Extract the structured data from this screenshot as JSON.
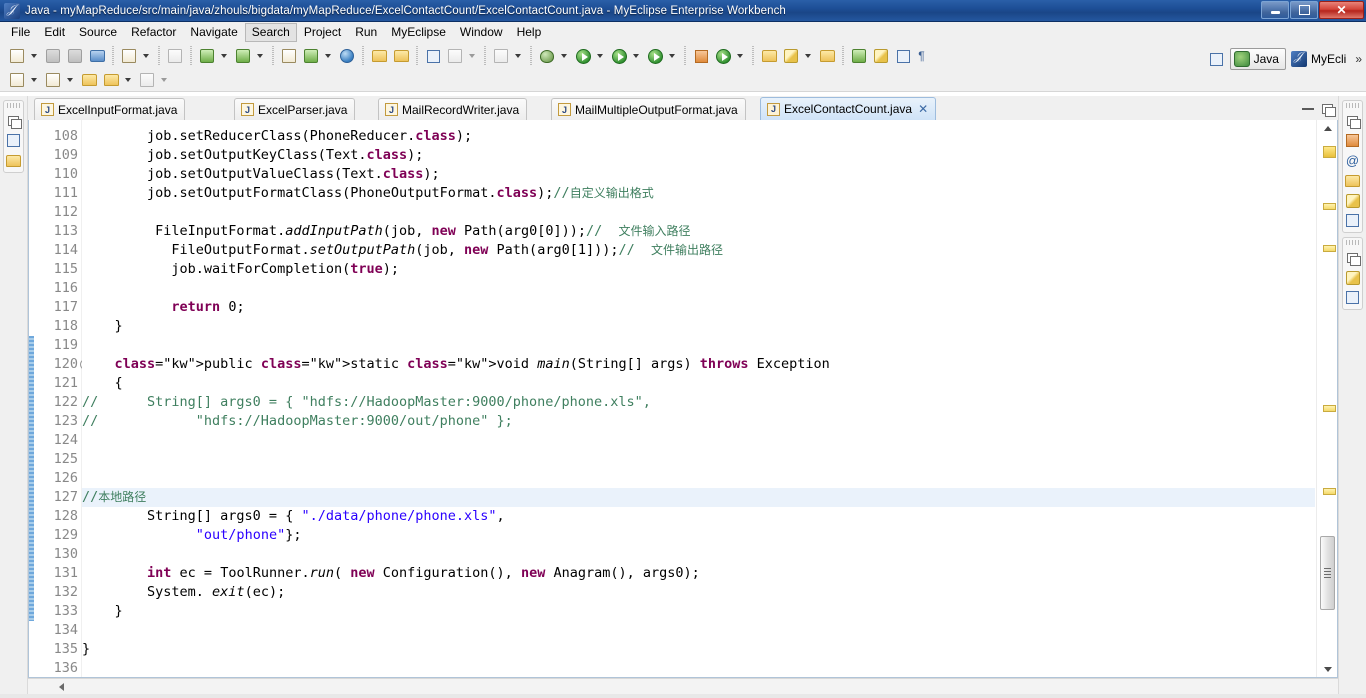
{
  "window": {
    "title": "Java - myMapReduce/src/main/java/zhouls/bigdata/myMapReduce/ExcelContactCount/ExcelContactCount.java - MyEclipse Enterprise Workbench",
    "app_icon": "myeclipse-icon",
    "controls": {
      "minimize": "–",
      "restore": "❐",
      "close": "✕"
    }
  },
  "menubar": {
    "items": [
      {
        "label": "File",
        "active": false
      },
      {
        "label": "Edit",
        "active": false
      },
      {
        "label": "Source",
        "active": false
      },
      {
        "label": "Refactor",
        "active": false
      },
      {
        "label": "Navigate",
        "active": false
      },
      {
        "label": "Search",
        "active": true
      },
      {
        "label": "Project",
        "active": false
      },
      {
        "label": "Run",
        "active": false
      },
      {
        "label": "MyEclipse",
        "active": false
      },
      {
        "label": "Window",
        "active": false
      },
      {
        "label": "Help",
        "active": false
      }
    ]
  },
  "perspective": {
    "open_perspective_label": "",
    "items": [
      {
        "label": "Java",
        "selected": true,
        "icon": "java-perspective-icon"
      },
      {
        "label": "MyEcli",
        "selected": false,
        "icon": "myeclipse-perspective-icon"
      }
    ],
    "overflow": "»"
  },
  "tabs": [
    {
      "label": "ExcelInputFormat.java",
      "active": false,
      "icon": "java-file-icon",
      "closable": false
    },
    {
      "label": "ExcelParser.java",
      "active": false,
      "icon": "java-file-icon",
      "closable": false
    },
    {
      "label": "MailRecordWriter.java",
      "active": false,
      "icon": "java-file-icon",
      "closable": false
    },
    {
      "label": "MailMultipleOutputFormat.java",
      "active": false,
      "icon": "java-file-icon",
      "closable": false
    },
    {
      "label": "ExcelContactCount.java",
      "active": true,
      "icon": "java-file-warning-icon",
      "closable": true,
      "close_glyph": "✕"
    }
  ],
  "editor": {
    "first_line": 108,
    "current_line": 127,
    "fold_marker_line": 120,
    "lines": [
      {
        "n": 108,
        "text": "        job.setReducerClass(PhoneReducer.class);"
      },
      {
        "n": 109,
        "text": "        job.setOutputKeyClass(Text.class);"
      },
      {
        "n": 110,
        "text": "        job.setOutputValueClass(Text.class);"
      },
      {
        "n": 111,
        "text": "        job.setOutputFormatClass(PhoneOutputFormat.class);//自定义输出格式"
      },
      {
        "n": 112,
        "text": ""
      },
      {
        "n": 113,
        "text": "         FileInputFormat.addInputPath(job, new Path(arg0[0]));//  文件输入路径"
      },
      {
        "n": 114,
        "text": "           FileOutputFormat.setOutputPath(job, new Path(arg0[1]));//  文件输出路径"
      },
      {
        "n": 115,
        "text": "           job.waitForCompletion(true);"
      },
      {
        "n": 116,
        "text": ""
      },
      {
        "n": 117,
        "text": "           return 0;"
      },
      {
        "n": 118,
        "text": "    }"
      },
      {
        "n": 119,
        "text": ""
      },
      {
        "n": 120,
        "text": "    public static void main(String[] args) throws Exception"
      },
      {
        "n": 121,
        "text": "    {"
      },
      {
        "n": 122,
        "text": "//      String[] args0 = { \"hdfs://HadoopMaster:9000/phone/phone.xls\","
      },
      {
        "n": 123,
        "text": "//            \"hdfs://HadoopMaster:9000/out/phone\" };"
      },
      {
        "n": 124,
        "text": ""
      },
      {
        "n": 125,
        "text": ""
      },
      {
        "n": 126,
        "text": ""
      },
      {
        "n": 127,
        "text": "//本地路径"
      },
      {
        "n": 128,
        "text": "        String[] args0 = { \"./data/phone/phone.xls\","
      },
      {
        "n": 129,
        "text": "              \"out/phone\"};"
      },
      {
        "n": 130,
        "text": ""
      },
      {
        "n": 131,
        "text": "        int ec = ToolRunner.run( new Configuration(), new Anagram(), args0);"
      },
      {
        "n": 132,
        "text": "        System. exit(ec);"
      },
      {
        "n": 133,
        "text": "    }"
      },
      {
        "n": 134,
        "text": ""
      },
      {
        "n": 135,
        "text": "}"
      },
      {
        "n": 136,
        "text": ""
      }
    ]
  },
  "left_fastview": {
    "icons": [
      "restore-icon",
      "outline-icon",
      "package-explorer-icon"
    ]
  },
  "right_fastview": {
    "group1": [
      "restore-icon",
      "problems-icon",
      "javadoc-icon",
      "declaration-icon",
      "database-explorer-icon",
      "console-icon"
    ],
    "group2": [
      "restore-icon",
      "tasks-icon",
      "properties-icon"
    ]
  },
  "colors": {
    "keyword": "#7f0055",
    "string": "#2a00ff",
    "comment": "#3f7f5f",
    "line_number": "#888888",
    "current_line_bg": "#eaf2fb",
    "titlebar": "#1d4e96",
    "close_button": "#d4453a",
    "marker": "#f4d96a",
    "change_bar": "#6fa8dc"
  },
  "toolbar": {
    "row1": [
      "new-icon",
      "new-dropdown",
      "save-icon",
      "save-all-icon",
      "print-icon",
      "sep",
      "new-wizard-icon",
      "new-wizard-dropdown",
      "sep",
      "web-20-icon",
      "sep",
      "deploy-icon",
      "deploy-dropdown",
      "undeploy-icon",
      "undeploy-dropdown",
      "sep",
      "server-icon",
      "server-dropdown",
      "run-server-icon",
      "run-server-dropdown",
      "sep",
      "globe-icon",
      "sep",
      "import-icon",
      "export-icon",
      "sep",
      "report-icon",
      "chart-icon",
      "chart-dropdown",
      "sep",
      "snapshot-icon",
      "snapshot-dropdown",
      "sep",
      "debug-icon",
      "debug-dropdown",
      "run-icon",
      "run-dropdown",
      "history-icon",
      "history-dropdown",
      "external-tools-icon",
      "external-tools-dropdown",
      "sep",
      "new-java-project-icon",
      "new-package-icon",
      "new-package-dropdown",
      "sep",
      "open-type-icon",
      "search-icon",
      "search-dropdown",
      "open-resource-icon",
      "sep",
      "next-annotation-icon",
      "highlight-icon",
      "block-select-icon",
      "whitespace-icon"
    ],
    "row2": [
      "back-icon",
      "back-dropdown",
      "forward-icon",
      "forward-dropdown",
      "prev-edit-icon",
      "prev-nav-icon",
      "prev-nav-dropdown",
      "next-nav-icon",
      "next-nav-dropdown"
    ]
  },
  "scrollbars": {
    "vertical": {
      "up_glyph": "▲",
      "down_glyph": "▼",
      "thumb_top_pct": 76,
      "thumb_height_pct": 14
    },
    "horizontal": {
      "left_glyph": "◀"
    }
  },
  "overview_markers": [
    {
      "top_pct": 2,
      "size": "big"
    },
    {
      "top_pct": 13,
      "size": "small"
    },
    {
      "top_pct": 21,
      "size": "small"
    },
    {
      "top_pct": 52,
      "size": "small"
    },
    {
      "top_pct": 68,
      "size": "small"
    }
  ]
}
